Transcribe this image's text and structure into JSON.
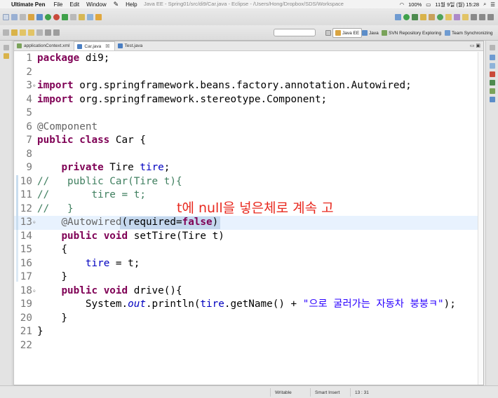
{
  "menubar": {
    "apple_glyph": "",
    "app_name": "Ultimate Pen",
    "items": [
      "File",
      "Edit",
      "Window",
      "Help"
    ],
    "window_title": "Java EE - Spring01/src/di9/Car.java - Eclipse - /Users/Hong/Dropbox/SDS/Workspace",
    "battery": "100%",
    "datetime": "11월 9일 (월)  15:28"
  },
  "toolbar": {
    "perspectives": [
      "Java EE",
      "Java",
      "SVN Repository Exploring",
      "Team Synchronizing"
    ]
  },
  "editor": {
    "tabs": [
      {
        "label": "applicationContext.xml",
        "active": false,
        "icon_color": "#7aa35a"
      },
      {
        "label": "Car.java",
        "active": true,
        "icon_color": "#4a7ec2",
        "close_glyph": "☒"
      },
      {
        "label": "Test.java",
        "active": false,
        "icon_color": "#4a7ec2"
      }
    ],
    "view_controls": "▭  ▣",
    "line_numbers": [
      "1",
      "2",
      "3",
      "4",
      "5",
      "6",
      "7",
      "8",
      "9",
      "10",
      "11",
      "12",
      "13",
      "14",
      "15",
      "16",
      "17",
      "18",
      "19",
      "20",
      "21",
      "22"
    ],
    "fold_markers": {
      "3": "⊕",
      "13": "⊖",
      "18": "⊖"
    },
    "code": [
      [
        [
          "kw",
          "package"
        ],
        [
          "t",
          " di9;"
        ]
      ],
      [],
      [
        [
          "kw",
          "import"
        ],
        [
          "t",
          " org.springframework.beans.factory.annotation.Autowired;"
        ]
      ],
      [
        [
          "kw",
          "import"
        ],
        [
          "t",
          " org.springframework.stereotype.Component;"
        ]
      ],
      [],
      [
        [
          "ann",
          "@Component"
        ]
      ],
      [
        [
          "kw",
          "public class"
        ],
        [
          "t",
          " Car {"
        ]
      ],
      [],
      [
        [
          "t",
          "    "
        ],
        [
          "kw",
          "private"
        ],
        [
          "t",
          " Tire "
        ],
        [
          "fld",
          "tire"
        ],
        [
          "t",
          ";"
        ]
      ],
      [
        [
          "cmt",
          "//   public Car(Tire t){"
        ]
      ],
      [
        [
          "cmt",
          "//       tire = t;"
        ]
      ],
      [
        [
          "cmt",
          "//   }"
        ]
      ],
      [
        [
          "t",
          "    "
        ],
        [
          "ann",
          "@Autowired"
        ],
        [
          "t",
          "(required="
        ],
        [
          "kw",
          "false"
        ],
        [
          "t",
          ")"
        ]
      ],
      [
        [
          "t",
          "    "
        ],
        [
          "kw",
          "public void"
        ],
        [
          "t",
          " setTire(Tire t)"
        ]
      ],
      [
        [
          "t",
          "    {"
        ]
      ],
      [
        [
          "t",
          "        "
        ],
        [
          "fld",
          "tire"
        ],
        [
          "t",
          " = t;"
        ]
      ],
      [
        [
          "t",
          "    }"
        ]
      ],
      [
        [
          "t",
          "    "
        ],
        [
          "kw",
          "public void"
        ],
        [
          "t",
          " drive(){"
        ]
      ],
      [
        [
          "t",
          "        System."
        ],
        [
          "fldi",
          "out"
        ],
        [
          "t",
          ".println("
        ],
        [
          "fld",
          "tire"
        ],
        [
          "t",
          ".getName() + "
        ],
        [
          "str",
          "\"으로 굴러가는 자동차 붕붕ㅋ\""
        ],
        [
          "t",
          ");"
        ]
      ],
      [
        [
          "t",
          "    }"
        ]
      ],
      [
        [
          "t",
          "}"
        ]
      ],
      []
    ],
    "annotation_note": "t에 null을 넣은체로 계속 고"
  },
  "statusbar": {
    "mode": "Writable",
    "insert": "Smart Insert",
    "position": "13 : 31"
  },
  "colors": {
    "keyword": "#7f0055",
    "field": "#0000c0",
    "annotation": "#646464",
    "string": "#2a00ff",
    "comment": "#3f7f5f",
    "note": "#e8281e"
  }
}
